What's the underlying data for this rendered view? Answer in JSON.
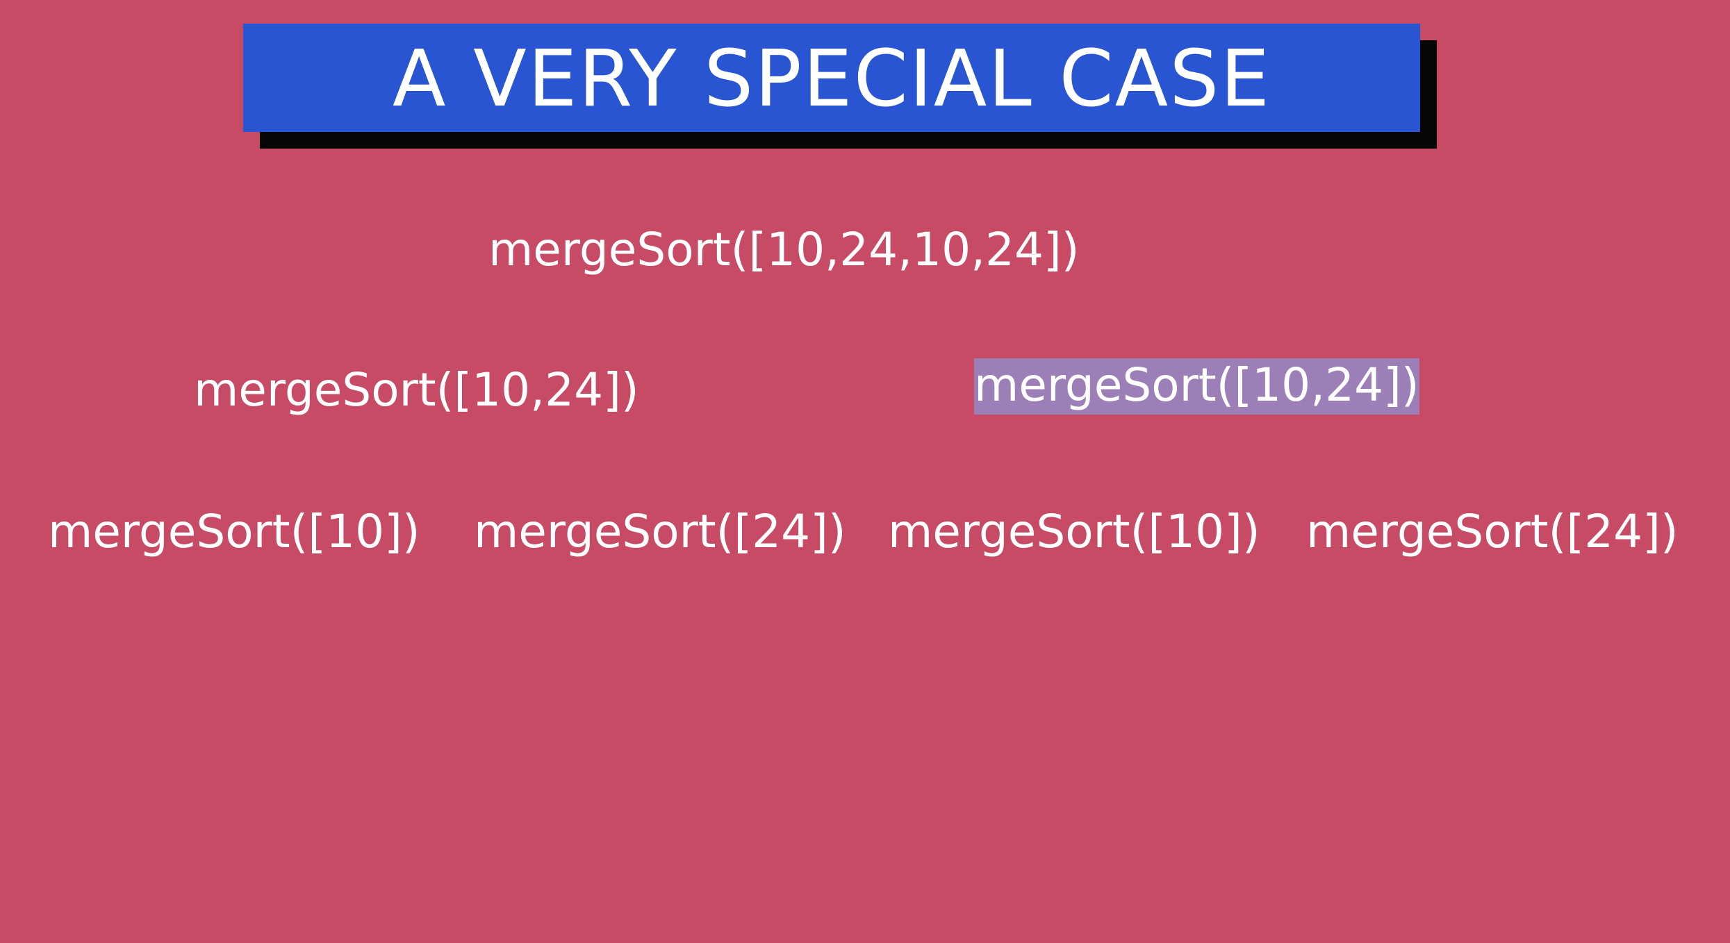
{
  "slide": {
    "title": "A VERY SPECIAL CASE",
    "colors": {
      "background": "#c84b66",
      "title_bar": "#2955d3",
      "title_shadow": "#050505",
      "highlight": "#9d7fb7",
      "text": "#ffffff"
    }
  },
  "tree": {
    "root": "mergeSort([10,24,10,24])",
    "level2": [
      "mergeSort([10,24])",
      "mergeSort([10,24])"
    ],
    "level3": [
      "mergeSort([10])",
      "mergeSort([24])",
      "mergeSort([10])",
      "mergeSort([24])"
    ]
  }
}
